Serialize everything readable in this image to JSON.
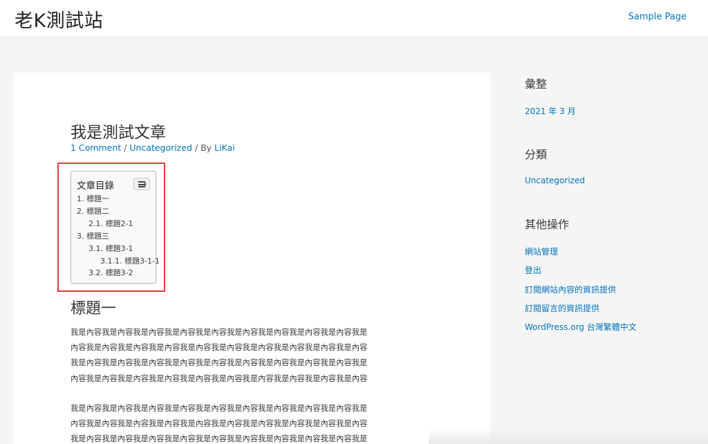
{
  "site": {
    "title": "老K測試站"
  },
  "nav": {
    "sample_page": "Sample Page"
  },
  "post": {
    "title": "我是測試文章",
    "meta": {
      "comments": "1 Comment",
      "sep1": " / ",
      "category": "Uncategorized",
      "sep2": " / By ",
      "author": "LiKai"
    }
  },
  "toc": {
    "title": "文章目錄",
    "items": [
      {
        "label": "1. 標題一"
      },
      {
        "label": "2. 標題二"
      },
      {
        "label": "2.1. 標題2-1"
      },
      {
        "label": "3. 標題三"
      },
      {
        "label": "3.1. 標題3-1"
      },
      {
        "label": "3.1.1. 標題3-1-1"
      },
      {
        "label": "3.2. 標題3-2"
      }
    ]
  },
  "content": {
    "heading1": "標題一",
    "para1": [
      "我是內容我是內容我是內容我是內容我是內容我是內容我是內容我是內容我是內容我是",
      "內容我是內容我是內容我是內容我是內容我是內容我是內容我是內容我是內容我是內容",
      "我是內容我是內容我是內容我是內容我是內容我是內容我是內容我是內容我是內容我是",
      "內容我是內容我是內容我是內容我是內容我是內容我是內容我是內容我是內容我是內容"
    ],
    "para2": [
      "我是內容我是內容我是內容我是內容我是內容我是內容我是內容我是內容我是內容我是",
      "內容我是內容我是內容我是內容我是內容我是內容我是內容我是內容我是內容我是內容",
      "我是內容我是內容我是內容我是內容我是內容我是內容我是內容我是內容我是內容我是"
    ]
  },
  "sidebar": {
    "archives_title": "彙整",
    "archives": [
      "2021 年 3 月"
    ],
    "categories_title": "分類",
    "categories": [
      "Uncategorized"
    ],
    "meta_title": "其他操作",
    "meta_links": [
      "網站管理",
      "登出",
      "訂閱網站內容的資訊提供",
      "訂閱留言的資訊提供",
      "WordPress.org 台灣繁體中文"
    ]
  },
  "colors": {
    "link": "#0274be",
    "highlight": "#e53935",
    "text": "#3a3a3a"
  }
}
